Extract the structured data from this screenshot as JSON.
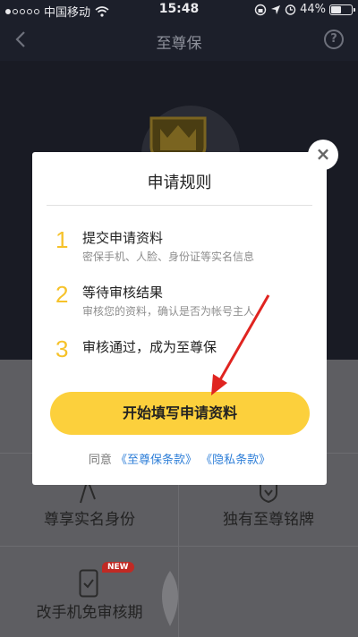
{
  "status_bar": {
    "carrier": "中国移动",
    "time": "15:48",
    "battery": "44%",
    "battery_level": 0.44
  },
  "nav": {
    "title": "至尊保",
    "back_icon": "chevron-left-icon",
    "help_icon": "question-circle-icon",
    "help_label": "?"
  },
  "features": [
    {
      "label": "尊享实名身份",
      "icon": "hand-icon"
    },
    {
      "label": "独有至尊铭牌",
      "icon": "shield-badge-icon"
    },
    {
      "label": "改手机免审核期",
      "icon": "phone-icon",
      "badge": "NEW"
    }
  ],
  "modal": {
    "title": "申请规则",
    "close_label": "×",
    "steps": [
      {
        "num": "1",
        "title": "提交申请资料",
        "desc": "密保手机、人脸、身份证等实名信息"
      },
      {
        "num": "2",
        "title": "等待审核结果",
        "desc": "审核您的资料，确认是否为帐号主人"
      },
      {
        "num": "3",
        "title": "审核通过，成为至尊保",
        "desc": ""
      }
    ],
    "cta_label": "开始填写申请资料",
    "agree_text": "同意",
    "link_terms": "《至尊保条款》",
    "link_privacy": "《隐私条款》"
  },
  "colors": {
    "accent_yellow": "#fcd03c",
    "step_num": "#f6c22a",
    "link_blue": "#2f7fd8",
    "annotation_red": "#e02420"
  }
}
